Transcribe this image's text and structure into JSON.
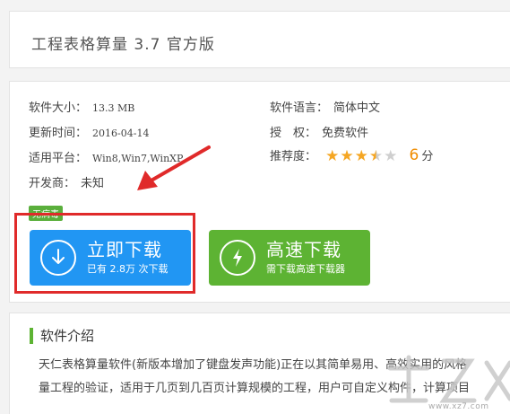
{
  "title": "工程表格算量 3.7 官方版",
  "info": {
    "size_label": "软件大小：",
    "size_value": "13.3 MB",
    "lang_label": "软件语言：",
    "lang_value": "简体中文",
    "updated_label": "更新时间：",
    "updated_value": "2016-04-14",
    "license_label": "授　权：",
    "license_value": "免费软件",
    "platform_label": "适用平台：",
    "platform_value": "Win8,Win7,WinXP",
    "rating_label": "推荐度：",
    "rating_stars": 3.5,
    "rating_max": 5,
    "score": "6",
    "score_unit": "分",
    "dev_label": "开发商：",
    "dev_value": "未知"
  },
  "badge": "无病毒",
  "buttons": {
    "download_main": "立即下载",
    "download_sub": "已有 2.8万 次下载",
    "fast_main": "高速下载",
    "fast_sub": "需下载高速下载器"
  },
  "intro": {
    "title": "软件介绍",
    "line1": "天仁表格算量软件(新版本增加了键盘发声功能)正在以其简单易用、高效实用的风格",
    "line2": "量工程的验证，适用于几页到几百页计算规模的工程，用户可自定义构件，计算项目"
  },
  "watermark": {
    "url": "www.xz7.com"
  },
  "colors": {
    "blue": "#2196f3",
    "green": "#5db333",
    "red": "#e02a2a",
    "star": "#f5a623"
  }
}
